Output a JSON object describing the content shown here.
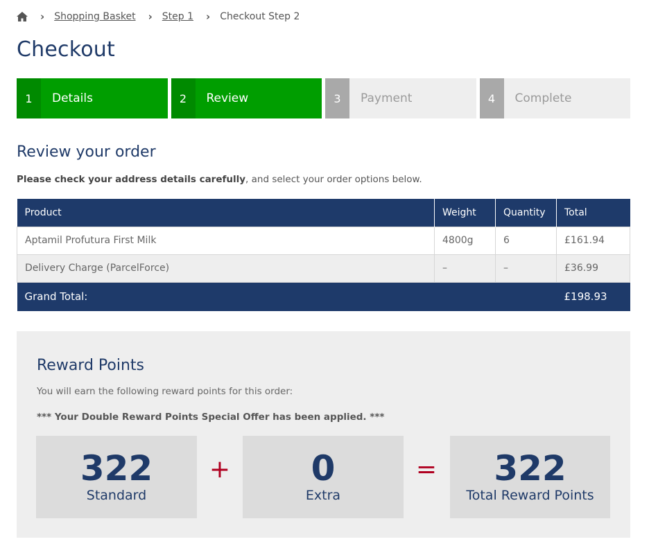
{
  "breadcrumb": {
    "home_icon": "home-icon",
    "items": [
      "Shopping Basket",
      "Step 1"
    ],
    "current": "Checkout Step 2"
  },
  "page_title": "Checkout",
  "steps": [
    {
      "num": "1",
      "label": "Details",
      "state": "done"
    },
    {
      "num": "2",
      "label": "Review",
      "state": "done"
    },
    {
      "num": "3",
      "label": "Payment",
      "state": "todo"
    },
    {
      "num": "4",
      "label": "Complete",
      "state": "todo"
    }
  ],
  "review": {
    "title": "Review your order",
    "intro_bold": "Please check your address details carefully",
    "intro_rest": ", and select your order options below."
  },
  "table": {
    "headers": [
      "Product",
      "Weight",
      "Quantity",
      "Total"
    ],
    "rows": [
      [
        "Aptamil Profutura First Milk",
        "4800g",
        "6",
        "£161.94"
      ],
      [
        "Delivery Charge (ParcelForce)",
        "–",
        "–",
        "£36.99"
      ]
    ],
    "grand_label": "Grand Total:",
    "grand_value": "£198.93"
  },
  "reward": {
    "title": "Reward Points",
    "text": "You will earn the following reward points for this order:",
    "offer": "*** Your Double Reward Points Special Offer has been applied. ***",
    "standard_value": "322",
    "standard_label": "Standard",
    "plus": "+",
    "extra_value": "0",
    "extra_label": "Extra",
    "equals": "=",
    "total_value": "322",
    "total_label": "Total Reward Points"
  },
  "colors": {
    "navy": "#1e3a6a",
    "green": "#009e00",
    "green_dark": "#008a00",
    "grey_step": "#a9a9a9",
    "operator_red": "#b00020"
  }
}
